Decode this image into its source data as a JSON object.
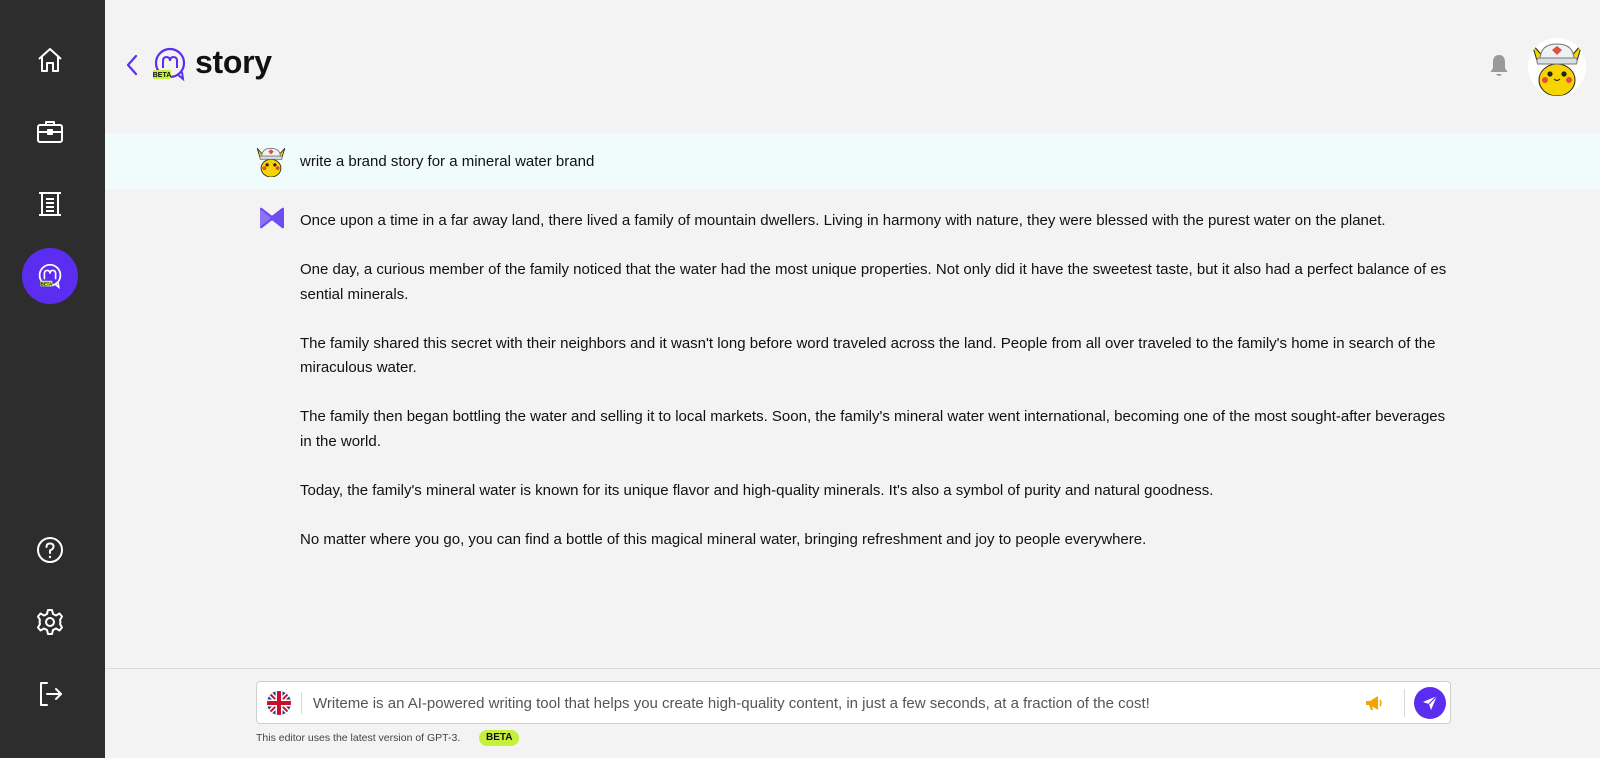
{
  "sidebar": {
    "items": [
      {
        "icon": "home-icon"
      },
      {
        "icon": "briefcase-icon"
      },
      {
        "icon": "scroll-icon"
      },
      {
        "icon": "writeme-logo-icon",
        "badge": "BETA",
        "active": true
      }
    ],
    "bottom_items": [
      {
        "icon": "help-icon"
      },
      {
        "icon": "gear-icon"
      },
      {
        "icon": "logout-icon"
      }
    ]
  },
  "header": {
    "title": "story",
    "logo_badge": "BETA"
  },
  "conversation": {
    "prompt": "write a brand story for a mineral water brand",
    "answer_paragraphs": [
      "Once upon a time in a far away land, there lived a family of mountain dwellers. Living in harmony with nature, they were blessed with the purest water on the planet.",
      "One day, a curious member of the family noticed that the water had the most unique properties. Not only did it have the sweetest taste, but it also had a perfect balance of essential minerals.",
      "The family shared this secret with their neighbors and it wasn't long before word traveled across the land. People from all over traveled to the family's home in search of the miraculous water.",
      "The family then began bottling the water and selling it to local markets. Soon, the family's mineral water went international, becoming one of the most sought-after beverages in the world.",
      "Today, the family's mineral water is known for its unique flavor and high-quality minerals. It's also a symbol of purity and natural goodness.",
      "No matter where you go, you can find a bottle of this magical mineral water, bringing refreshment and joy to people everywhere."
    ]
  },
  "input": {
    "placeholder": "Writeme is an AI-powered writing tool that helps you create high-quality content, in just a few seconds, at a fraction of the cost!",
    "value": ""
  },
  "footer": {
    "note": "This editor uses the latest version of GPT-3.",
    "badge": "BETA"
  },
  "colors": {
    "sidebar_bg": "#2d2d2d",
    "accent": "#5b2df0",
    "beta_badge": "#c5f03b",
    "prompt_row_bg": "#f0fcfc",
    "page_bg": "#f3f3f3"
  }
}
